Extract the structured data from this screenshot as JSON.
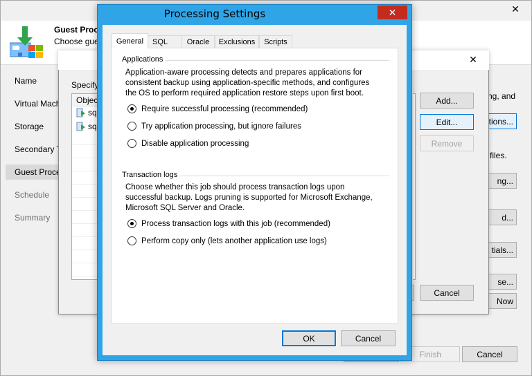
{
  "main": {
    "header_title": "Guest Proc",
    "header_subtitle": "Choose gue",
    "close": "✕",
    "nav": [
      {
        "label": "Name"
      },
      {
        "label": "Virtual Mach"
      },
      {
        "label": "Storage"
      },
      {
        "label": "Secondary T"
      },
      {
        "label": "Guest Proce"
      },
      {
        "label": "Schedule"
      },
      {
        "label": "Summary"
      }
    ],
    "right_fragments": {
      "text1": "ng, and",
      "applications_btn": "ations...",
      "files": "files.",
      "indexing_btn": "ng...",
      "btn_d": "d...",
      "credentials_btn": "tials...",
      "browse_btn": "se...",
      "now_btn": "Now"
    },
    "finish": "Finish",
    "cancel": "Cancel"
  },
  "mid": {
    "close": "✕",
    "specify": "Specify",
    "list_header": "Objec",
    "items": [
      {
        "label": "sq"
      },
      {
        "label": "sq"
      }
    ],
    "add": "Add...",
    "edit": "Edit...",
    "remove": "Remove",
    "cancel": "Cancel"
  },
  "dialog": {
    "title": "Processing Settings",
    "close": "✕",
    "tabs": [
      {
        "label": "General"
      },
      {
        "label": "SQL"
      },
      {
        "label": "Oracle"
      },
      {
        "label": "Exclusions"
      },
      {
        "label": "Scripts"
      }
    ],
    "applications": {
      "title": "Applications",
      "desc_lines": [
        "Application-aware processing detects and prepares applications for",
        "consistent backup using application-specific methods, and configures",
        "the OS to perform required application restore steps upon first boot."
      ],
      "options": [
        {
          "label": "Require successful processing  (recommended)",
          "checked": true
        },
        {
          "label": "Try application processing, but ignore failures",
          "checked": false
        },
        {
          "label": "Disable application processing",
          "checked": false
        }
      ]
    },
    "logs": {
      "title": "Transaction logs",
      "desc_lines": [
        "Choose whether this job should process transaction logs upon",
        "successful backup. Logs pruning is supported for Microsoft Exchange,",
        "Microsoft SQL Server and Oracle."
      ],
      "options": [
        {
          "label": "Process transaction logs with this job (recommended)",
          "checked": true
        },
        {
          "label": "Perform copy only (lets another application use logs)",
          "checked": false
        }
      ]
    },
    "ok": "OK",
    "cancel": "Cancel"
  }
}
